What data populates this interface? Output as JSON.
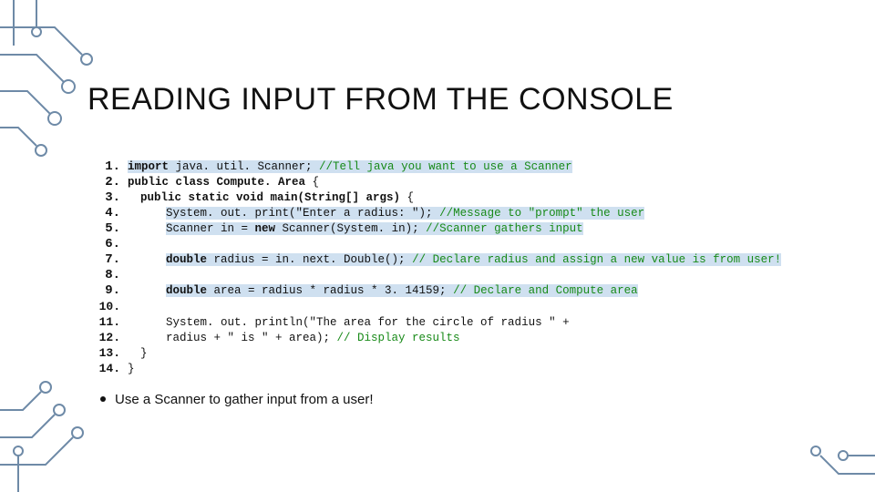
{
  "title": "READING INPUT FROM THE CONSOLE",
  "lines": {
    "n1": "1.",
    "n2": "2.",
    "n3": "3.",
    "n4": "4.",
    "n5": "5.",
    "n6": "6.",
    "n7": "7.",
    "n8": "8.",
    "n9": "9.",
    "n10": "10.",
    "n11": "11.",
    "n12": "12.",
    "n13": "13.",
    "n14": "14."
  },
  "code": {
    "l1a": "import",
    "l1b": " java. util. Scanner;",
    "l1c": " //Tell java you want to use a Scanner",
    "l2a": "public class Compute. Area",
    "l2b": " {",
    "l3a": "public static void main(String[] args)",
    "l3b": " {",
    "l4a": "System. out. print(\"Enter a radius: \");",
    "l4c": " //Message to \"prompt\" the user",
    "l5a": "Scanner in = ",
    "l5b": "new",
    "l5c": " Scanner(System. in);",
    "l5d": "  //Scanner gathers input",
    "l7a": "double",
    "l7b": " radius = in. next. Double();",
    "l7c": " // Declare radius and assign a new value is from user!",
    "l9a": "double",
    "l9b": " area = radius * radius * 3. 14159;",
    "l9c": " // Declare and Compute area",
    "l11a": "System. out. println(\"The area for the circle of radius \" +",
    "l12a": "radius + \" is \" + area);",
    "l12c": " // Display results",
    "l13a": "}",
    "l14a": "}"
  },
  "bullet": "Use a Scanner to gather input from a user!"
}
